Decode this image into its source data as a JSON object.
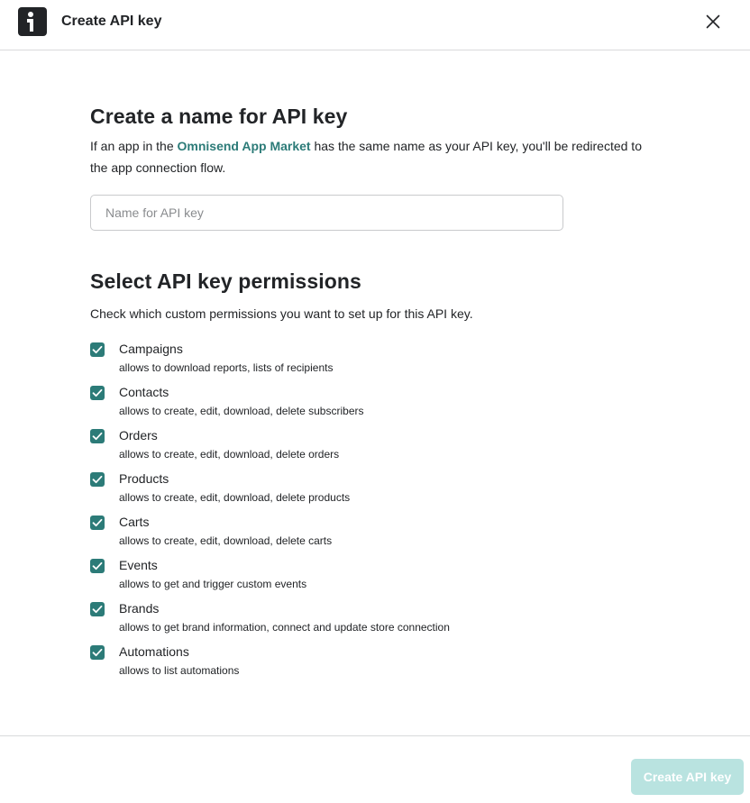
{
  "header": {
    "title": "Create API key",
    "logo_icon": "omnisend-logo-icon",
    "close_icon": "close-icon"
  },
  "name_section": {
    "title": "Create a name for API key",
    "desc_prefix": "If an app in the ",
    "desc_link": "Omnisend App Market",
    "desc_suffix": " has the same name as your API key, you'll be redirected to the app connection flow.",
    "input_value": "",
    "input_placeholder": "Name for API key"
  },
  "permissions_section": {
    "title": "Select API key permissions",
    "description": "Check which custom permissions you want to set up for this API key.",
    "items": [
      {
        "name": "Campaigns",
        "description": "allows to download reports, lists of recipients",
        "checked": true
      },
      {
        "name": "Contacts",
        "description": "allows to create, edit, download, delete subscribers",
        "checked": true
      },
      {
        "name": "Orders",
        "description": "allows to create, edit, download, delete orders",
        "checked": true
      },
      {
        "name": "Products",
        "description": "allows to create, edit, download, delete products",
        "checked": true
      },
      {
        "name": "Carts",
        "description": "allows to create, edit, download, delete carts",
        "checked": true
      },
      {
        "name": "Events",
        "description": "allows to get and trigger custom events",
        "checked": true
      },
      {
        "name": "Brands",
        "description": "allows to get brand information, connect and update store connection",
        "checked": true
      },
      {
        "name": "Automations",
        "description": "allows to list automations",
        "checked": true
      }
    ]
  },
  "footer": {
    "create_label": "Create API key",
    "create_disabled": true
  },
  "colors": {
    "accent": "#2c7b78",
    "button_disabled": "#b9e3e0",
    "text": "#222427",
    "border": "#d9dadb"
  }
}
